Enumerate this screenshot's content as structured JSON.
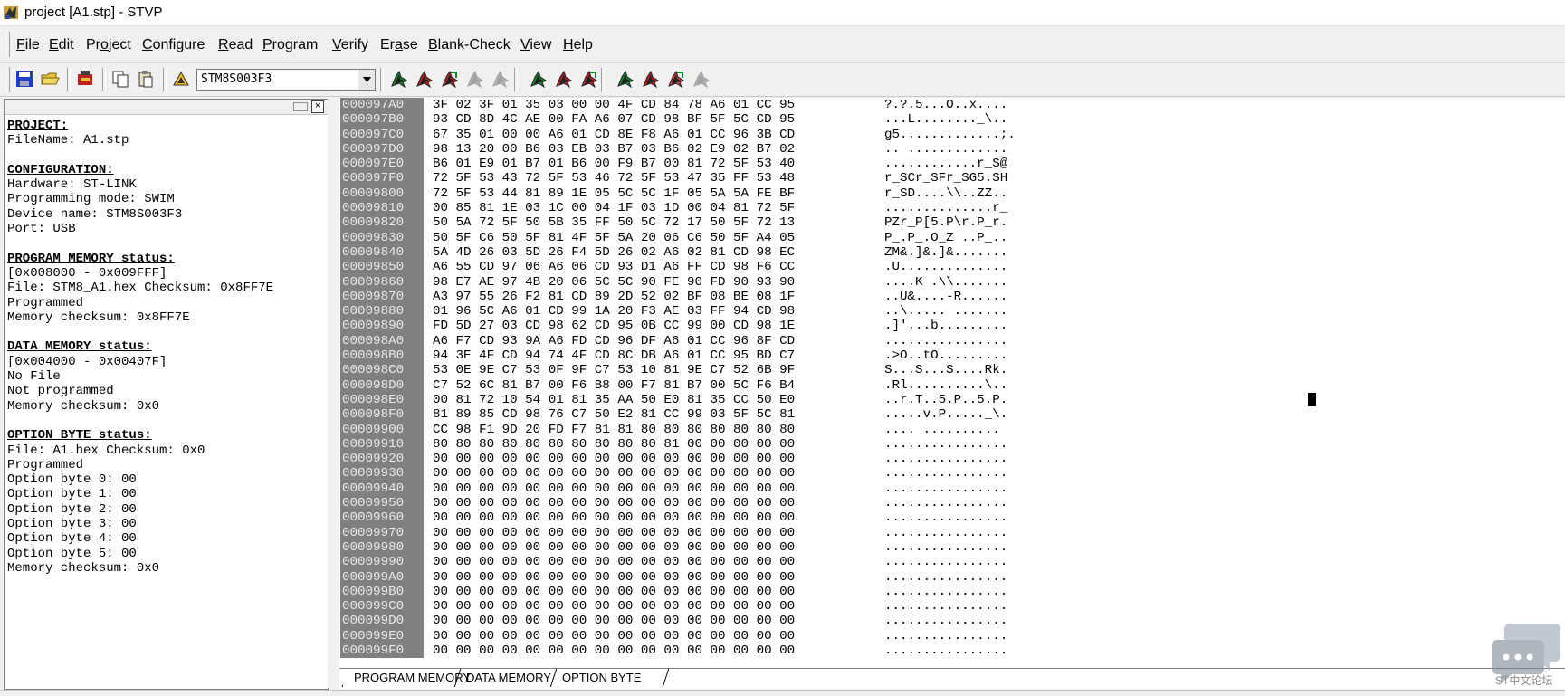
{
  "window": {
    "title": "project [A1.stp] - STVP"
  },
  "menu": [
    {
      "pre": "",
      "ul": "F",
      "post": "ile"
    },
    {
      "pre": "",
      "ul": "E",
      "post": "dit"
    },
    {
      "pre": "Pr",
      "ul": "o",
      "post": "ject"
    },
    {
      "pre": "",
      "ul": "C",
      "post": "onfigure"
    },
    {
      "pre": "",
      "ul": "R",
      "post": "ead"
    },
    {
      "pre": "",
      "ul": "P",
      "post": "rogram"
    },
    {
      "pre": "",
      "ul": "V",
      "post": "erify"
    },
    {
      "pre": "Er",
      "ul": "a",
      "post": "se"
    },
    {
      "pre": "",
      "ul": "B",
      "post": "lank-Check"
    },
    {
      "pre": "",
      "ul": "V",
      "post": "iew"
    },
    {
      "pre": "",
      "ul": "H",
      "post": "elp"
    }
  ],
  "toolbar": {
    "device": "STM8S003F3"
  },
  "info": [
    {
      "t": "PROJECT:",
      "h": true
    },
    {
      "t": "FileName: A1.stp"
    },
    {
      "t": ""
    },
    {
      "t": "CONFIGURATION:",
      "h": true
    },
    {
      "t": "Hardware: ST-LINK"
    },
    {
      "t": "Programming mode: SWIM"
    },
    {
      "t": "Device name: STM8S003F3"
    },
    {
      "t": "Port: USB"
    },
    {
      "t": ""
    },
    {
      "t": "PROGRAM MEMORY status:",
      "h": true
    },
    {
      "t": "[0x008000 - 0x009FFF]"
    },
    {
      "t": "File: STM8_A1.hex Checksum: 0x8FF7E"
    },
    {
      "t": "Programmed"
    },
    {
      "t": "Memory checksum: 0x8FF7E"
    },
    {
      "t": ""
    },
    {
      "t": "DATA MEMORY status:",
      "h": true
    },
    {
      "t": "[0x004000 - 0x00407F]"
    },
    {
      "t": "No File"
    },
    {
      "t": "Not programmed"
    },
    {
      "t": "Memory checksum: 0x0"
    },
    {
      "t": ""
    },
    {
      "t": "OPTION BYTE status:",
      "h": true
    },
    {
      "t": "File: A1.hex Checksum: 0x0"
    },
    {
      "t": "Programmed"
    },
    {
      "t": "Option byte 0: 00"
    },
    {
      "t": "Option byte 1: 00"
    },
    {
      "t": "Option byte 2: 00"
    },
    {
      "t": "Option byte 3: 00"
    },
    {
      "t": "Option byte 4: 00"
    },
    {
      "t": "Option byte 5: 00"
    },
    {
      "t": "Memory checksum: 0x0"
    }
  ],
  "hex": [
    {
      "a": "000097A0",
      "b": "3F 02 3F 01 35 03 00 00 4F CD 84 78 A6 01 CC 95",
      "c": "?.?.5...O..x...."
    },
    {
      "a": "000097B0",
      "b": "93 CD 8D 4C AE 00 FA A6 07 CD 98 BF 5F 5C CD 95",
      "c": "...L........_\\.."
    },
    {
      "a": "000097C0",
      "b": "67 35 01 00 00 A6 01 CD 8E F8 A6 01 CC 96 3B CD",
      "c": "g5.............;."
    },
    {
      "a": "000097D0",
      "b": "98 13 20 00 B6 03 EB 03 B7 03 B6 02 E9 02 B7 02",
      "c": ".. ............."
    },
    {
      "a": "000097E0",
      "b": "B6 01 E9 01 B7 01 B6 00 F9 B7 00 81 72 5F 53 40",
      "c": "............r_S@"
    },
    {
      "a": "000097F0",
      "b": "72 5F 53 43 72 5F 53 46 72 5F 53 47 35 FF 53 48",
      "c": "r_SCr_SFr_SG5.SH"
    },
    {
      "a": "00009800",
      "b": "72 5F 53 44 81 89 1E 05 5C 5C 1F 05 5A 5A FE BF",
      "c": "r_SD....\\\\..ZZ.."
    },
    {
      "a": "00009810",
      "b": "00 85 81 1E 03 1C 00 04 1F 03 1D 00 04 81 72 5F",
      "c": "..............r_"
    },
    {
      "a": "00009820",
      "b": "50 5A 72 5F 50 5B 35 FF 50 5C 72 17 50 5F 72 13",
      "c": "PZr_P[5.P\\r.P_r."
    },
    {
      "a": "00009830",
      "b": "50 5F C6 50 5F 81 4F 5F 5A 20 06 C6 50 5F A4 05",
      "c": "P_.P_.O_Z ..P_.."
    },
    {
      "a": "00009840",
      "b": "5A 4D 26 03 5D 26 F4 5D 26 02 A6 02 81 CD 98 EC",
      "c": "ZM&.]&.]&......."
    },
    {
      "a": "00009850",
      "b": "A6 55 CD 97 06 A6 06 CD 93 D1 A6 FF CD 98 F6 CC",
      "c": ".U.............."
    },
    {
      "a": "00009860",
      "b": "98 E7 AE 97 4B 20 06 5C 5C 90 FE 90 FD 90 93 90",
      "c": "....K .\\\\......."
    },
    {
      "a": "00009870",
      "b": "A3 97 55 26 F2 81 CD 89 2D 52 02 BF 08 BE 08 1F",
      "c": "..U&....-R......"
    },
    {
      "a": "00009880",
      "b": "01 96 5C A6 01 CD 99 1A 20 F3 AE 03 FF 94 CD 98",
      "c": "..\\..... ......."
    },
    {
      "a": "00009890",
      "b": "FD 5D 27 03 CD 98 62 CD 95 0B CC 99 00 CD 98 1E",
      "c": ".]'...b........."
    },
    {
      "a": "000098A0",
      "b": "A6 F7 CD 93 9A A6 FD CD 96 DF A6 01 CC 96 8F CD",
      "c": "................"
    },
    {
      "a": "000098B0",
      "b": "94 3E 4F CD 94 74 4F CD 8C DB A6 01 CC 95 BD C7",
      "c": ".>O..tO........."
    },
    {
      "a": "000098C0",
      "b": "53 0E 9E C7 53 0F 9F C7 53 10 81 9E C7 52 6B 9F",
      "c": "S...S...S....Rk."
    },
    {
      "a": "000098D0",
      "b": "C7 52 6C 81 B7 00 F6 B8 00 F7 81 B7 00 5C F6 B4",
      "c": ".Rl..........\\.."
    },
    {
      "a": "000098E0",
      "b": "00 81 72 10 54 01 81 35 AA 50 E0 81 35 CC 50 E0",
      "c": "..r.T..5.P..5.P."
    },
    {
      "a": "000098F0",
      "b": "81 89 85 CD 98 76 C7 50 E2 81 CC 99 03 5F 5C 81",
      "c": ".....v.P....._\\."
    },
    {
      "a": "00009900",
      "b": "CC 98 F1 9D 20 FD F7 81 81 80 80 80 80 80 80 80",
      "c": ".... .........."
    },
    {
      "a": "00009910",
      "b": "80 80 80 80 80 80 80 80 80 80 81 00 00 00 00 00",
      "c": "................"
    },
    {
      "a": "00009920",
      "b": "00 00 00 00 00 00 00 00 00 00 00 00 00 00 00 00",
      "c": "................"
    },
    {
      "a": "00009930",
      "b": "00 00 00 00 00 00 00 00 00 00 00 00 00 00 00 00",
      "c": "................"
    },
    {
      "a": "00009940",
      "b": "00 00 00 00 00 00 00 00 00 00 00 00 00 00 00 00",
      "c": "................"
    },
    {
      "a": "00009950",
      "b": "00 00 00 00 00 00 00 00 00 00 00 00 00 00 00 00",
      "c": "................"
    },
    {
      "a": "00009960",
      "b": "00 00 00 00 00 00 00 00 00 00 00 00 00 00 00 00",
      "c": "................"
    },
    {
      "a": "00009970",
      "b": "00 00 00 00 00 00 00 00 00 00 00 00 00 00 00 00",
      "c": "................"
    },
    {
      "a": "00009980",
      "b": "00 00 00 00 00 00 00 00 00 00 00 00 00 00 00 00",
      "c": "................"
    },
    {
      "a": "00009990",
      "b": "00 00 00 00 00 00 00 00 00 00 00 00 00 00 00 00",
      "c": "................"
    },
    {
      "a": "000099A0",
      "b": "00 00 00 00 00 00 00 00 00 00 00 00 00 00 00 00",
      "c": "................"
    },
    {
      "a": "000099B0",
      "b": "00 00 00 00 00 00 00 00 00 00 00 00 00 00 00 00",
      "c": "................"
    },
    {
      "a": "000099C0",
      "b": "00 00 00 00 00 00 00 00 00 00 00 00 00 00 00 00",
      "c": "................"
    },
    {
      "a": "000099D0",
      "b": "00 00 00 00 00 00 00 00 00 00 00 00 00 00 00 00",
      "c": "................"
    },
    {
      "a": "000099E0",
      "b": "00 00 00 00 00 00 00 00 00 00 00 00 00 00 00 00",
      "c": "................"
    },
    {
      "a": "000099F0",
      "b": "00 00 00 00 00 00 00 00 00 00 00 00 00 00 00 00",
      "c": "................"
    }
  ],
  "tabs": [
    "PROGRAM MEMORY",
    "DATA MEMORY",
    "OPTION BYTE"
  ],
  "watermark": {
    "text": "ST中文论坛"
  }
}
